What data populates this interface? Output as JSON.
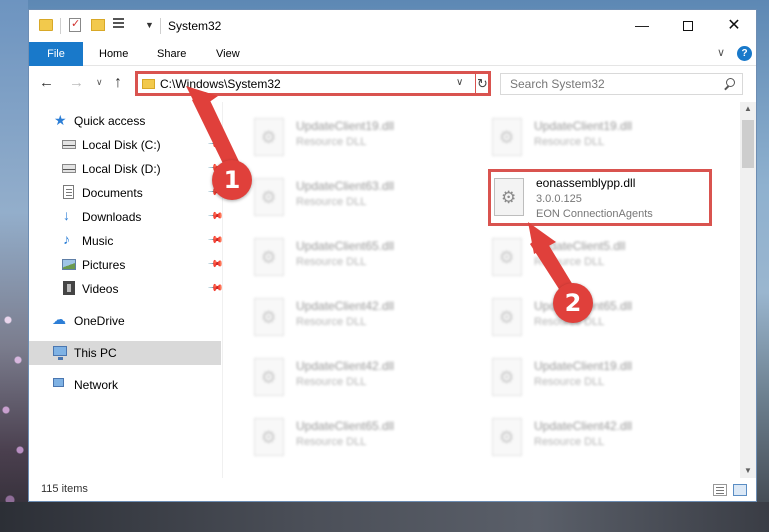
{
  "window": {
    "title": "System32",
    "controls": {
      "minimize": "—",
      "close": "✕"
    }
  },
  "ribbon": {
    "tabs": [
      "File",
      "Home",
      "Share",
      "View"
    ],
    "help": "?"
  },
  "navigation": {
    "address_path": "C:\\Windows\\System32",
    "search_placeholder": "Search System32"
  },
  "sidebar": {
    "quick_access": "Quick access",
    "items": [
      {
        "label": "Local Disk (C:)",
        "icon": "drive-icon",
        "pinned": true
      },
      {
        "label": "Local Disk (D:)",
        "icon": "drive-icon",
        "pinned": true
      },
      {
        "label": "Documents",
        "icon": "documents-icon",
        "pinned": true
      },
      {
        "label": "Downloads",
        "icon": "downloads-icon",
        "pinned": true
      },
      {
        "label": "Music",
        "icon": "music-icon",
        "pinned": true
      },
      {
        "label": "Pictures",
        "icon": "pictures-icon",
        "pinned": true
      },
      {
        "label": "Videos",
        "icon": "videos-icon",
        "pinned": true
      }
    ],
    "onedrive": "OneDrive",
    "this_pc": "This PC",
    "network": "Network"
  },
  "files": {
    "background_tiles": [
      {
        "name": "UpdateClient19.dll",
        "type": "Resource DLL"
      },
      {
        "name": "UpdateClient19.dll",
        "type": "Resource DLL"
      },
      {
        "name": "UpdateClient63.dll",
        "type": "Resource DLL"
      },
      {
        "name": "UpdateClient65.dll",
        "type": "Resource DLL"
      },
      {
        "name": "UpdateClient5.dll",
        "type": "Resource DLL"
      },
      {
        "name": "UpdateClient42.dll",
        "type": "Resource DLL"
      },
      {
        "name": "UpdateClient65.dll",
        "type": "Resource DLL"
      },
      {
        "name": "UpdateClient42.dll",
        "type": "Resource DLL"
      },
      {
        "name": "UpdateClient19.dll",
        "type": "Resource DLL"
      },
      {
        "name": "UpdateClient65.dll",
        "type": "Resource DLL"
      },
      {
        "name": "UpdateClient42.dll",
        "type": "Resource DLL"
      }
    ],
    "highlighted": {
      "name": "eonassemblypp.dll",
      "version": "3.0.0.125",
      "company": "EON ConnectionAgents"
    }
  },
  "status": {
    "item_count": "115 items"
  },
  "annotations": {
    "step1": "1",
    "step2": "2",
    "color": "#e0403b"
  },
  "colors": {
    "accent": "#1979ca",
    "highlight_border": "#d9534f",
    "selected_row": "#d9d9d9"
  }
}
